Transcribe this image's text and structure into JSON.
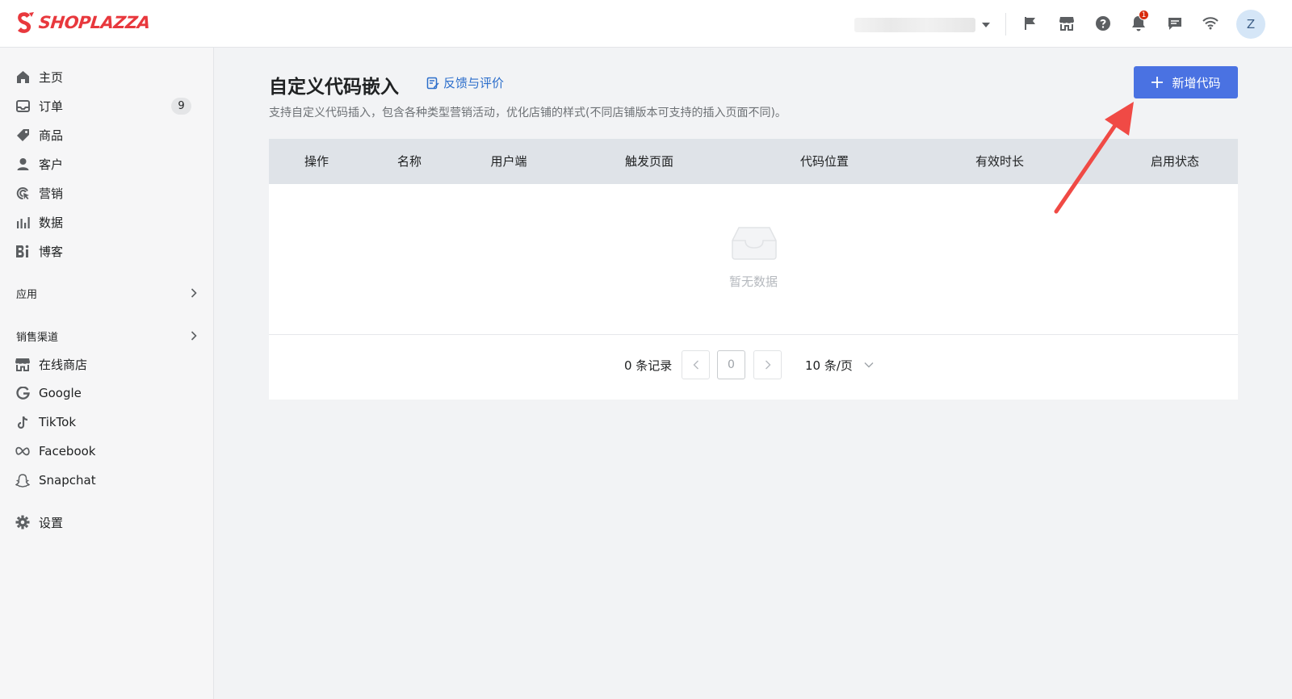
{
  "header": {
    "brand": "SHOPLAZZA",
    "avatar_initial": "Z",
    "notification_count": "1",
    "icons": [
      "flag-icon",
      "store-icon",
      "help-icon",
      "bell-icon",
      "message-icon",
      "wifi-icon"
    ]
  },
  "sidebar": {
    "main_items": [
      {
        "label": "主页",
        "icon": "home-icon"
      },
      {
        "label": "订单",
        "icon": "orders-icon",
        "badge": "9"
      },
      {
        "label": "商品",
        "icon": "tag-icon"
      },
      {
        "label": "客户",
        "icon": "customer-icon"
      },
      {
        "label": "营销",
        "icon": "marketing-icon"
      },
      {
        "label": "数据",
        "icon": "analytics-icon"
      },
      {
        "label": "博客",
        "icon": "blog-icon"
      }
    ],
    "apps_section": "应用",
    "channels_section": "销售渠道",
    "channel_items": [
      {
        "label": "在线商店",
        "icon": "store-icon"
      },
      {
        "label": "Google",
        "icon": "google-icon"
      },
      {
        "label": "TikTok",
        "icon": "tiktok-icon"
      },
      {
        "label": "Facebook",
        "icon": "meta-icon"
      },
      {
        "label": "Snapchat",
        "icon": "snapchat-icon"
      }
    ],
    "settings": {
      "label": "设置",
      "icon": "gear-icon"
    }
  },
  "main": {
    "title": "自定义代码嵌入",
    "feedback_link": "反馈与评价",
    "subtitle": "支持自定义代码插入，包含各种类型营销活动，优化店铺的样式(不同店铺版本可支持的插入页面不同)。",
    "add_button": "新增代码",
    "columns": [
      "操作",
      "名称",
      "用户端",
      "触发页面",
      "代码位置",
      "有效时长",
      "启用状态"
    ],
    "empty_text": "暂无数据",
    "pagination": {
      "record_count": "0 条记录",
      "current_page": "0",
      "page_size": "10 条/页"
    }
  },
  "colors": {
    "primary": "#4a72e2",
    "brand_red": "#e8383d",
    "link": "#2c6ecb",
    "annotation_arrow": "#f04a45"
  }
}
